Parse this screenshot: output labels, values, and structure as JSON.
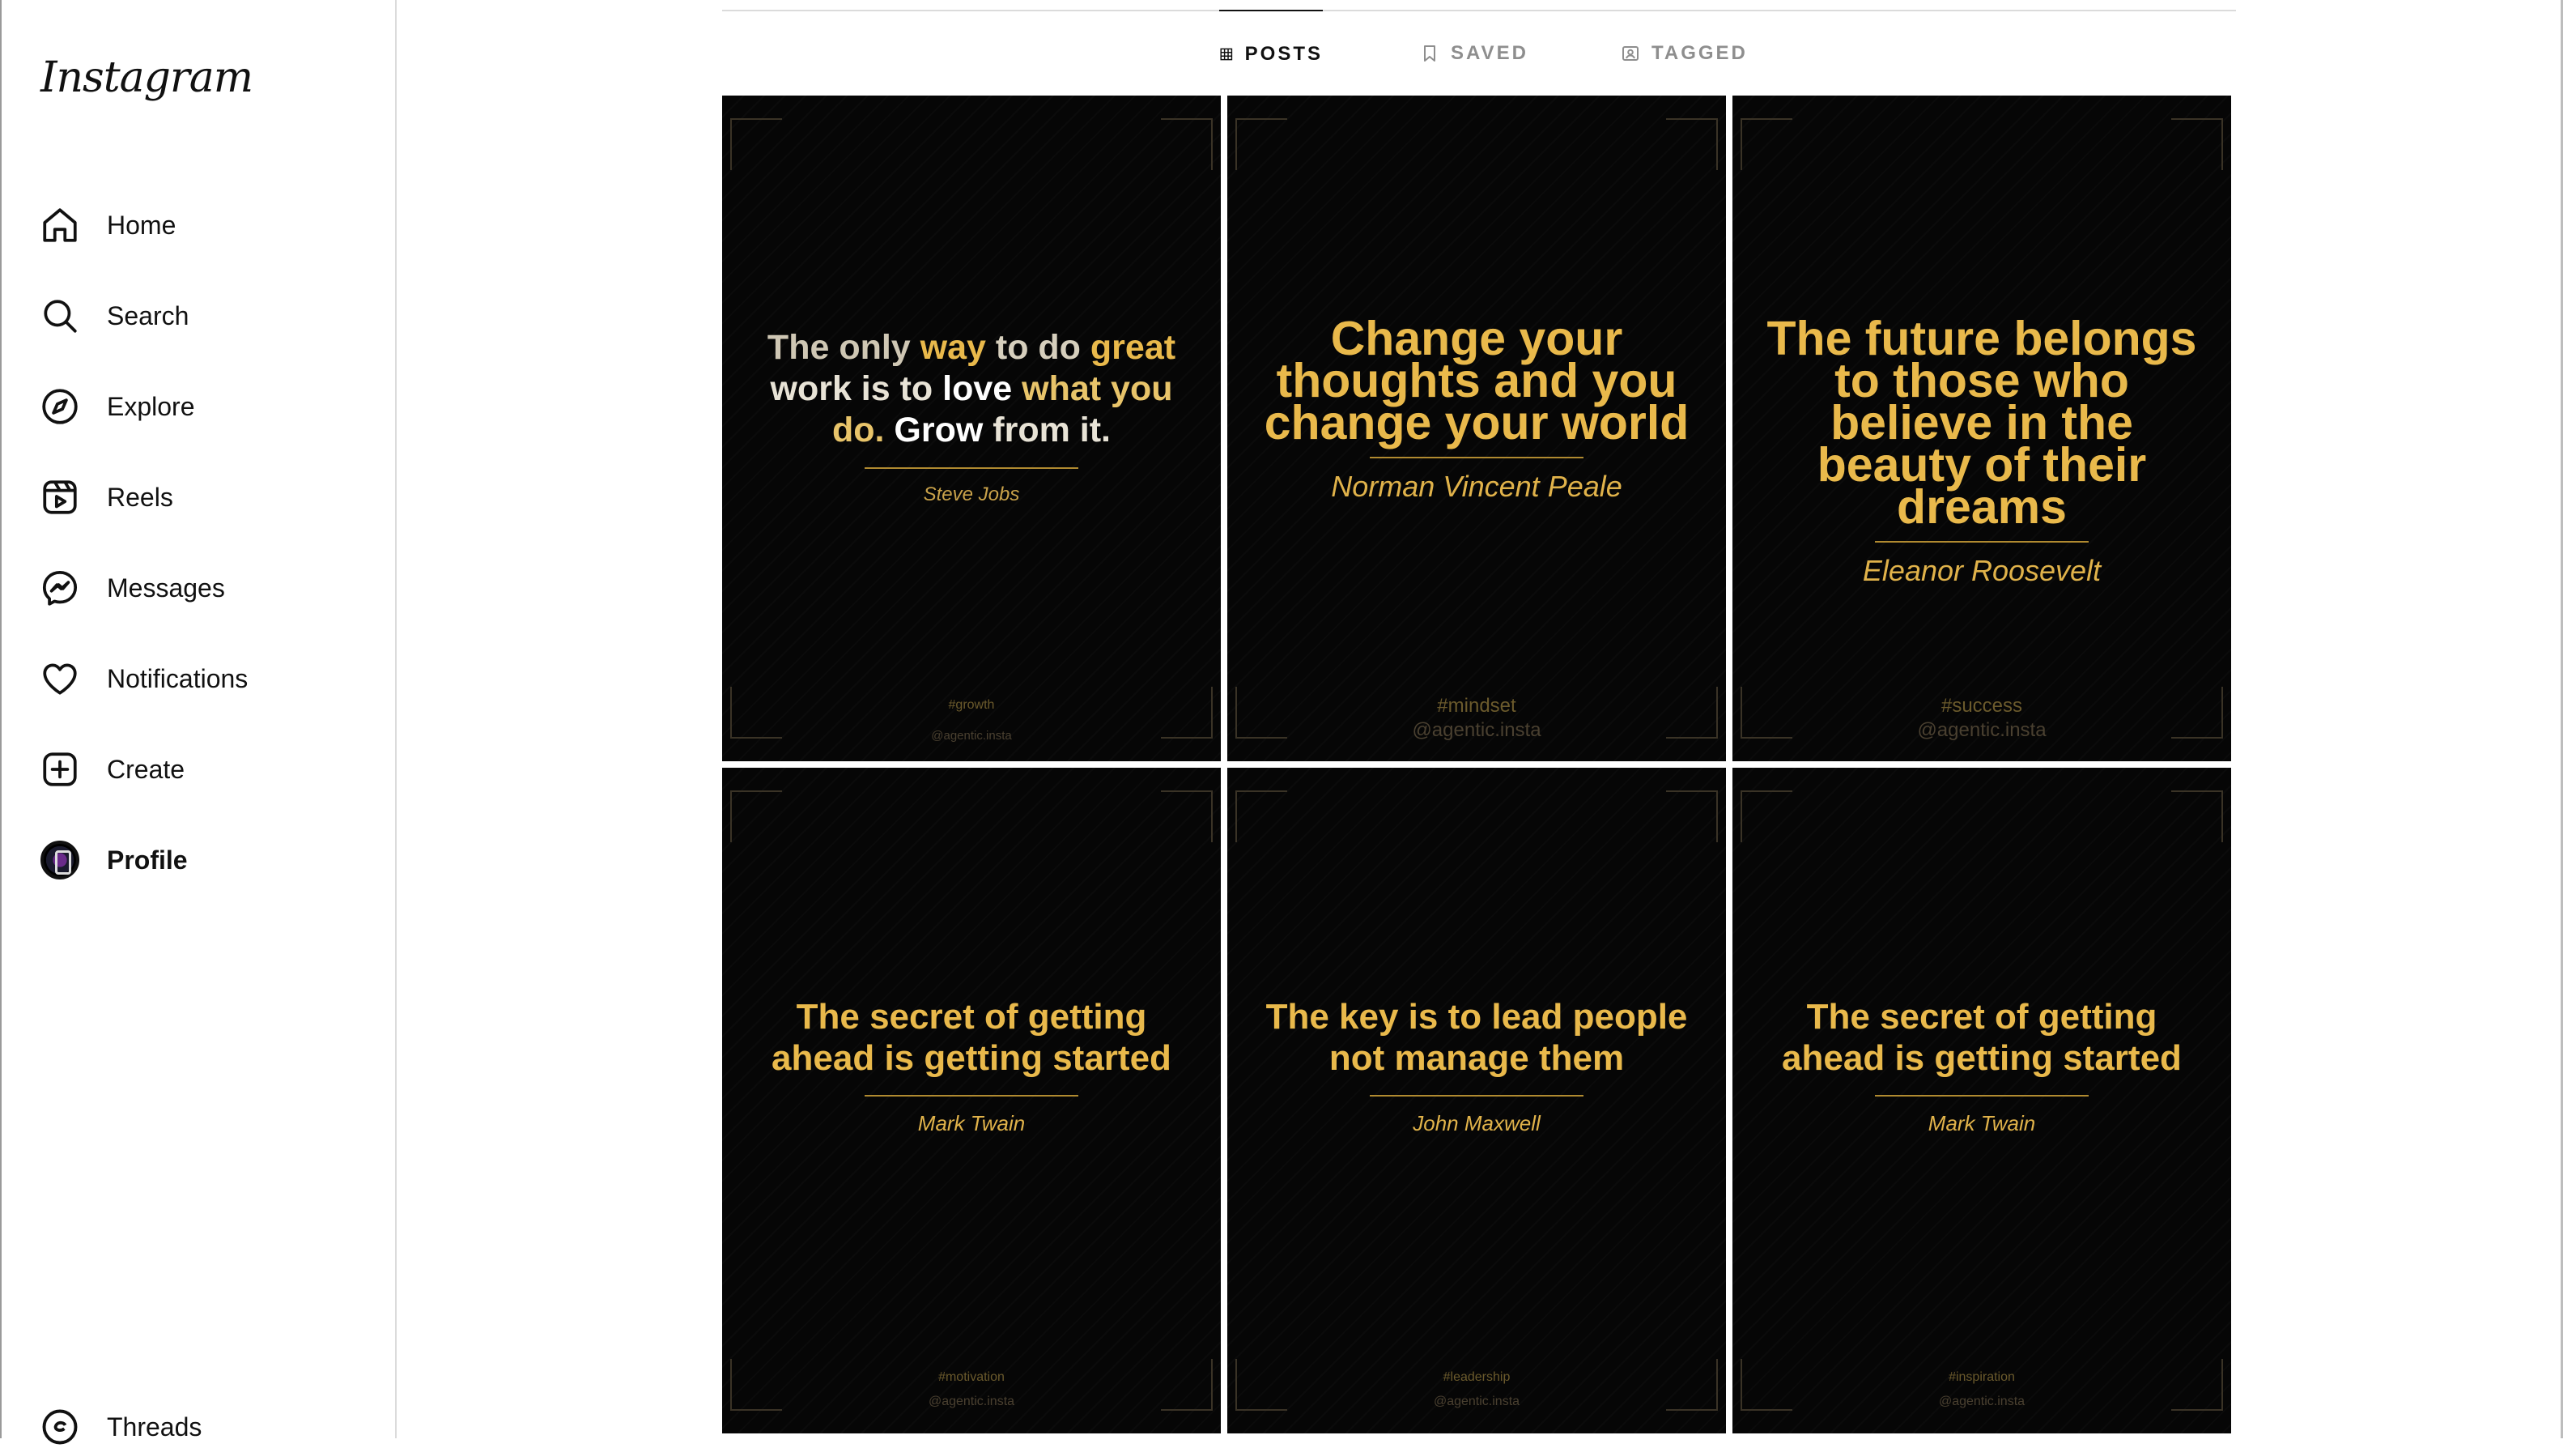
{
  "app": {
    "logo_text": "Instagram"
  },
  "sidebar": {
    "items": [
      {
        "label": "Home",
        "icon": "home-icon"
      },
      {
        "label": "Search",
        "icon": "search-icon"
      },
      {
        "label": "Explore",
        "icon": "compass-icon"
      },
      {
        "label": "Reels",
        "icon": "reels-icon"
      },
      {
        "label": "Messages",
        "icon": "messenger-icon"
      },
      {
        "label": "Notifications",
        "icon": "heart-icon"
      },
      {
        "label": "Create",
        "icon": "plus-square-icon"
      },
      {
        "label": "Profile",
        "icon": "avatar",
        "active": true
      }
    ],
    "threads_label": "Threads"
  },
  "tabs": [
    {
      "label": "POSTS",
      "icon": "grid-icon",
      "active": true
    },
    {
      "label": "SAVED",
      "icon": "bookmark-icon",
      "active": false
    },
    {
      "label": "TAGGED",
      "icon": "tag-person-icon",
      "active": false
    }
  ],
  "posts": [
    {
      "quote_parts": [
        "The only ",
        "way",
        " to do ",
        "great",
        " work is to ",
        "love",
        " what you do. ",
        "Grow",
        " from it."
      ],
      "author": "Steve Jobs",
      "hashtag": "#growth",
      "handle": "@agentic.insta"
    },
    {
      "quote": "Change your thoughts and you change your world",
      "author": "Norman Vincent Peale",
      "hashtag": "#mindset",
      "handle": "@agentic.insta"
    },
    {
      "quote": "The future belongs to those who believe in the beauty of their dreams",
      "author": "Eleanor Roosevelt",
      "hashtag": "#success",
      "handle": "@agentic.insta"
    },
    {
      "quote": "The secret of getting ahead is getting started",
      "author": "Mark Twain",
      "hashtag": "#motivation",
      "handle": "@agentic.insta"
    },
    {
      "quote": "The key is to lead people not manage them",
      "author": "John Maxwell",
      "hashtag": "#leadership",
      "handle": "@agentic.insta"
    },
    {
      "quote": "The secret of getting ahead is getting started",
      "author": "Mark Twain",
      "hashtag": "#inspiration",
      "handle": "@agentic.insta"
    }
  ],
  "colors": {
    "quote_gold": "#e9b94b",
    "post_background": "#060606",
    "muted_tab": "#8e8e8e"
  }
}
